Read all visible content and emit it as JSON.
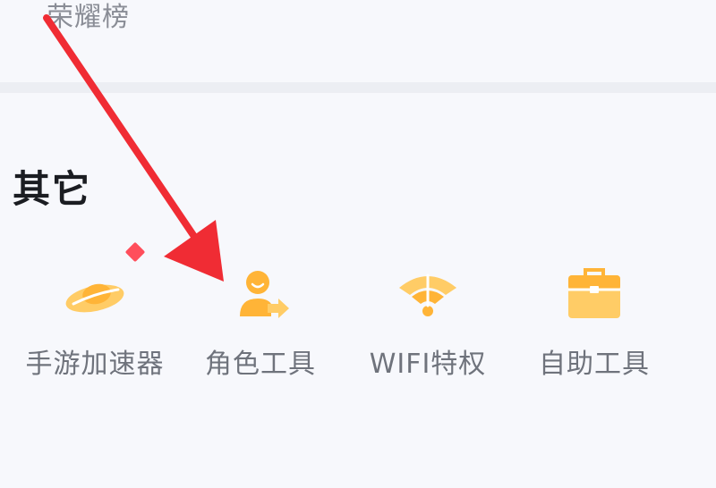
{
  "top": {
    "leaderboard_label": "荣耀榜"
  },
  "section": {
    "title": "其它"
  },
  "tools": [
    {
      "label": "手游加速器",
      "icon": "game-accelerator-icon"
    },
    {
      "label": "角色工具",
      "icon": "character-tool-icon"
    },
    {
      "label": "WIFI特权",
      "icon": "wifi-privilege-icon"
    },
    {
      "label": "自助工具",
      "icon": "self-service-toolbox-icon"
    }
  ],
  "colors": {
    "icon_primary": "#ffb437",
    "icon_secondary": "#ffcc66",
    "badge": "#ff4e5b",
    "arrow": "#f02c34",
    "title_text": "#1b1d22",
    "label_text": "#6f737c"
  }
}
